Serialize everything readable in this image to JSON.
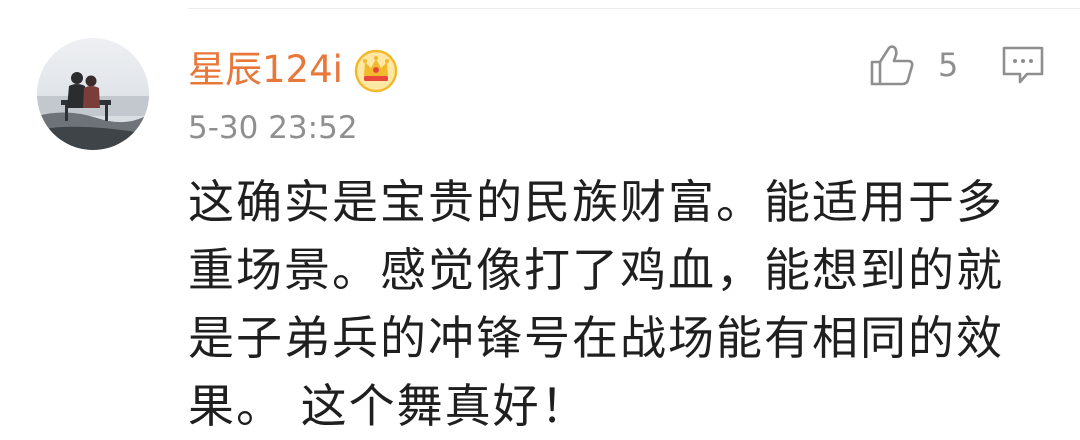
{
  "comment": {
    "username": "星辰124i",
    "timestamp": "5-30 23:52",
    "like_count": "5",
    "text_lines": [
      "这确实是宝贵的民族财富。能适用于多",
      "重场景。感觉像打了鸡血，能想到的就",
      "是子弟兵的冲锋号在战场能有相同的效",
      "果。 这个舞真好！"
    ]
  },
  "icons": {
    "avatar": "avatar-photo",
    "badge": "crown-icon",
    "like": "thumbs-up-icon",
    "reply": "comment-icon"
  },
  "colors": {
    "username": "#e8773a",
    "meta": "#8f8f8f",
    "text": "#1f1f1f",
    "badge_gold": "#f2b92c",
    "badge_red": "#e8473a"
  }
}
